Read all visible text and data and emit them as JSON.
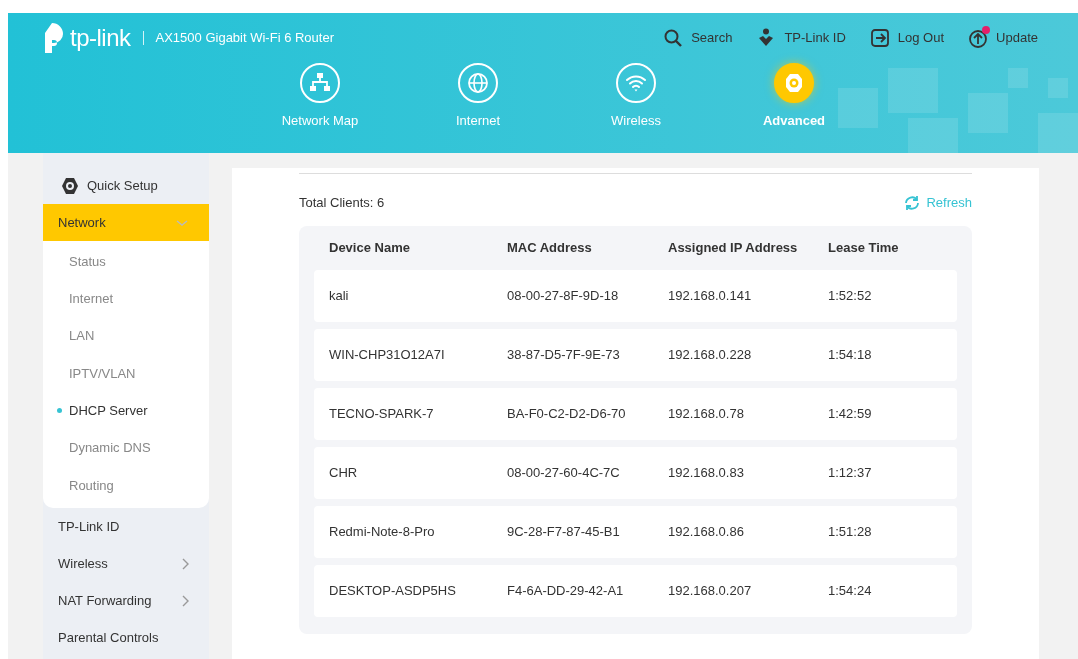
{
  "header": {
    "logo_text": "tp-link",
    "model": "AX1500 Gigabit Wi-Fi 6 Router",
    "top_links": [
      {
        "kind": "search",
        "label": "Search",
        "badge": false
      },
      {
        "kind": "id",
        "label": "TP-Link ID",
        "badge": false
      },
      {
        "kind": "logout",
        "label": "Log Out",
        "badge": false
      },
      {
        "kind": "update",
        "label": "Update",
        "badge": true
      }
    ],
    "nav_tabs": [
      {
        "kind": "map",
        "label": "Network Map",
        "selected": false
      },
      {
        "kind": "globe",
        "label": "Internet",
        "selected": false
      },
      {
        "kind": "wifi",
        "label": "Wireless",
        "selected": false
      },
      {
        "kind": "gear",
        "label": "Advanced",
        "selected": true
      }
    ]
  },
  "sidebar": {
    "items": [
      {
        "kind": "quick",
        "label": "Quick Setup",
        "selected": false
      },
      {
        "kind": "group",
        "label": "Network",
        "selected": true,
        "expanded": true,
        "children": [
          {
            "label": "Status",
            "selected": false
          },
          {
            "label": "Internet",
            "selected": false
          },
          {
            "label": "LAN",
            "selected": false
          },
          {
            "label": "IPTV/VLAN",
            "selected": false
          },
          {
            "label": "DHCP Server",
            "selected": true
          },
          {
            "label": "Dynamic DNS",
            "selected": false
          },
          {
            "label": "Routing",
            "selected": false
          }
        ]
      },
      {
        "kind": "plain",
        "label": "TP-Link ID",
        "selected": false
      },
      {
        "kind": "group",
        "label": "Wireless",
        "selected": false,
        "expanded": false
      },
      {
        "kind": "group",
        "label": "NAT Forwarding",
        "selected": false,
        "expanded": false
      },
      {
        "kind": "plain",
        "label": "Parental Controls",
        "selected": false
      }
    ]
  },
  "clients": {
    "total": "Total Clients: 6",
    "refresh": "Refresh",
    "columns": [
      "Device Name",
      "MAC Address",
      "Assigned IP Address",
      "Lease Time"
    ],
    "rows": [
      [
        "kali",
        "08-00-27-8F-9D-18",
        "192.168.0.141",
        "1:52:52"
      ],
      [
        "WIN-CHP31O12A7I",
        "38-87-D5-7F-9E-73",
        "192.168.0.228",
        "1:54:18"
      ],
      [
        "TECNO-SPARK-7",
        "BA-F0-C2-D2-D6-70",
        "192.168.0.78",
        "1:42:59"
      ],
      [
        "CHR",
        "08-00-27-60-4C-7C",
        "192.168.0.83",
        "1:12:37"
      ],
      [
        "Redmi-Note-8-Pro",
        "9C-28-F7-87-45-B1",
        "192.168.0.86",
        "1:51:28"
      ],
      [
        "DESKTOP-ASDP5HS",
        "F4-6A-DD-29-42-A1",
        "192.168.0.207",
        "1:54:24"
      ]
    ]
  }
}
